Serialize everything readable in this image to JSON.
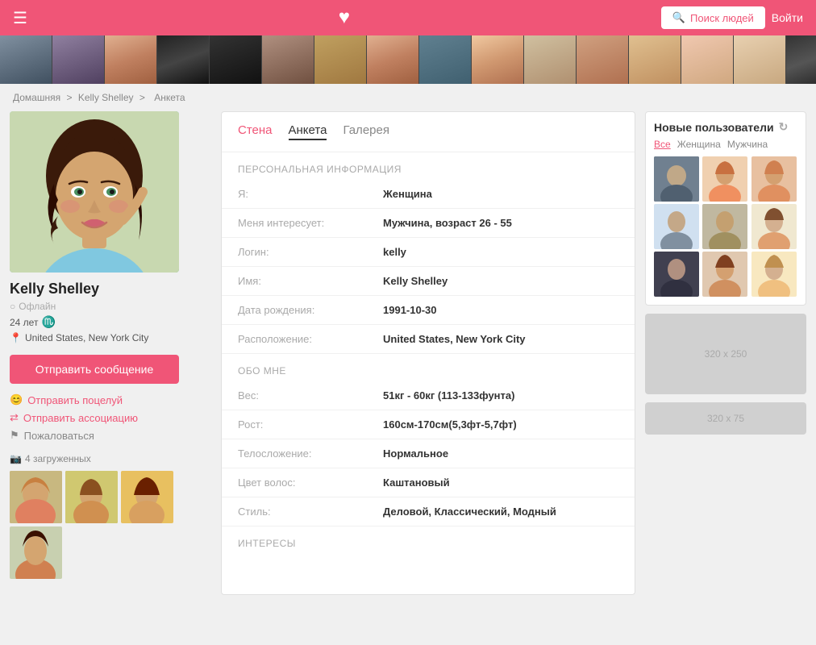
{
  "header": {
    "menu_icon": "☰",
    "heart_icon": "♥",
    "search_btn": "Поиск людей",
    "login_btn": "Войти"
  },
  "breadcrumb": {
    "home": "Домашняя",
    "sep1": ">",
    "user": "Kelly Shelley",
    "sep2": ">",
    "page": "Анкета"
  },
  "tabs": [
    {
      "label": "Стена",
      "id": "wall"
    },
    {
      "label": "Анкета",
      "id": "profile",
      "active": true
    },
    {
      "label": "Галерея",
      "id": "gallery"
    }
  ],
  "profile": {
    "name": "Kelly Shelley",
    "status": "Офлайн",
    "age": "24 лет",
    "zodiac": "♏",
    "location": "United States, New York City",
    "send_msg": "Отправить сообщение",
    "actions": [
      {
        "label": "Отправить поцелуй",
        "icon": "kiss"
      },
      {
        "label": "Отправить ассоциацию",
        "icon": "assoc"
      },
      {
        "label": "Пожаловаться",
        "icon": "flag"
      }
    ],
    "photos_label": "4 загруженных"
  },
  "personal_info": {
    "section_title": "ПЕРСОНАЛЬНАЯ ИНФОРМАЦИЯ",
    "fields": [
      {
        "label": "Я:",
        "value": "Женщина"
      },
      {
        "label": "Меня интересует:",
        "value": "Мужчина, возраст 26 - 55"
      },
      {
        "label": "Логин:",
        "value": "kelly"
      },
      {
        "label": "Имя:",
        "value": "Kelly Shelley"
      },
      {
        "label": "Дата рождения:",
        "value": "1991-10-30"
      },
      {
        "label": "Расположение:",
        "value": "United States, New York City"
      }
    ]
  },
  "about_me": {
    "section_title": "ОБО МНЕ",
    "fields": [
      {
        "label": "Вес:",
        "value": "51кг - 60кг (113-133фунта)"
      },
      {
        "label": "Рост:",
        "value": "160см-170см(5,3фт-5,7фт)"
      },
      {
        "label": "Телосложение:",
        "value": "Нормальное"
      },
      {
        "label": "Цвет волос:",
        "value": "Каштановый"
      },
      {
        "label": "Стиль:",
        "value": "Деловой, Классический, Модный"
      }
    ]
  },
  "interests": {
    "section_title": "ИНТЕРЕСЫ"
  },
  "new_users": {
    "title": "Новые пользователи",
    "refresh": "↻",
    "filters": [
      "Все",
      "Женщина",
      "Мужчина"
    ]
  },
  "ads": [
    {
      "label": "320 x 250"
    },
    {
      "label": "320 x 75"
    }
  ]
}
